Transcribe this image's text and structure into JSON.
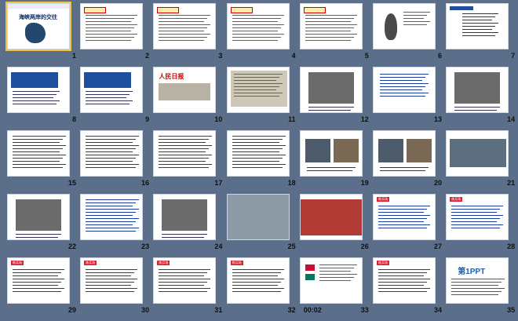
{
  "slides": [
    {
      "n": "1",
      "title": "海峡两岸的交往",
      "kind": "title"
    },
    {
      "n": "2",
      "kind": "text-red"
    },
    {
      "n": "3",
      "kind": "text-red"
    },
    {
      "n": "4",
      "kind": "text-red"
    },
    {
      "n": "5",
      "kind": "text-red"
    },
    {
      "n": "6",
      "kind": "map"
    },
    {
      "n": "7",
      "kind": "diagram"
    },
    {
      "n": "8",
      "kind": "bluebox"
    },
    {
      "n": "9",
      "kind": "bluebox"
    },
    {
      "n": "10",
      "kind": "newspaper",
      "paper": "人民日报"
    },
    {
      "n": "11",
      "kind": "doc"
    },
    {
      "n": "12",
      "kind": "photo"
    },
    {
      "n": "13",
      "kind": "outline"
    },
    {
      "n": "14",
      "kind": "photo"
    },
    {
      "n": "15",
      "kind": "text-blue"
    },
    {
      "n": "16",
      "kind": "text-blue"
    },
    {
      "n": "17",
      "kind": "text-blue"
    },
    {
      "n": "18",
      "kind": "text-blue"
    },
    {
      "n": "19",
      "kind": "photos"
    },
    {
      "n": "20",
      "kind": "photos"
    },
    {
      "n": "21",
      "kind": "photo-wide"
    },
    {
      "n": "22",
      "kind": "photo"
    },
    {
      "n": "23",
      "kind": "text-blue"
    },
    {
      "n": "24",
      "kind": "photo"
    },
    {
      "n": "25",
      "kind": "photo-plane"
    },
    {
      "n": "26",
      "kind": "photo-banner"
    },
    {
      "n": "27",
      "kind": "quiz"
    },
    {
      "n": "28",
      "kind": "quiz"
    },
    {
      "n": "29",
      "kind": "quiz"
    },
    {
      "n": "30",
      "kind": "quiz"
    },
    {
      "n": "31",
      "kind": "quiz"
    },
    {
      "n": "32",
      "kind": "quiz"
    },
    {
      "n": "33",
      "kind": "flags"
    },
    {
      "n": "34",
      "kind": "quiz"
    },
    {
      "n": "35",
      "kind": "logo",
      "logo": "第1PPT"
    }
  ],
  "timestamp": "00:02",
  "quiz_badge": "练兵场",
  "selected_slide": "1"
}
